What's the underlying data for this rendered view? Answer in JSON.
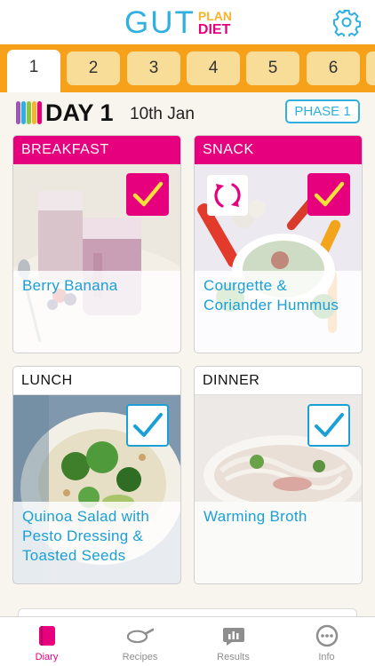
{
  "app": {
    "logo_main": "GUT",
    "logo_top": "PLAN",
    "logo_bottom": "DIET"
  },
  "day_tabs": [
    {
      "label": "1",
      "active": true
    },
    {
      "label": "2"
    },
    {
      "label": "3"
    },
    {
      "label": "4"
    },
    {
      "label": "5"
    },
    {
      "label": "6"
    }
  ],
  "day": {
    "title": "DAY 1",
    "date": "10th Jan",
    "phase_button": "PHASE 1",
    "stripe_colors": [
      "#9b59b6",
      "#2fb0e0",
      "#8cc63f",
      "#f7b32b",
      "#e6007e"
    ]
  },
  "meals": {
    "breakfast": {
      "label": "BREAKFAST",
      "recipe": "Berry Banana",
      "checked": true,
      "accent": "#e6007e"
    },
    "snack": {
      "label": "SNACK",
      "recipe": "Courgette & Coriander Hummus",
      "checked": true,
      "swap_icon": "swap-icon",
      "accent": "#e6007e"
    },
    "lunch": {
      "label": "LUNCH",
      "recipe": "Quinoa Salad with Pesto Dressing & Toasted Seeds",
      "checked": true,
      "accent": "#1a9fd6"
    },
    "dinner": {
      "label": "DINNER",
      "recipe": "Warming Broth",
      "checked": true,
      "accent": "#1a9fd6"
    }
  },
  "bottom_nav": [
    {
      "label": "Diary",
      "icon": "diary-icon",
      "active": true
    },
    {
      "label": "Recipes",
      "icon": "pan-icon"
    },
    {
      "label": "Results",
      "icon": "results-icon"
    },
    {
      "label": "Info",
      "icon": "info-icon"
    }
  ],
  "colors": {
    "brand_blue": "#2fb0e0",
    "brand_pink": "#e6007e",
    "brand_orange": "#f7a11a",
    "tab_inactive": "#f7dd98"
  }
}
